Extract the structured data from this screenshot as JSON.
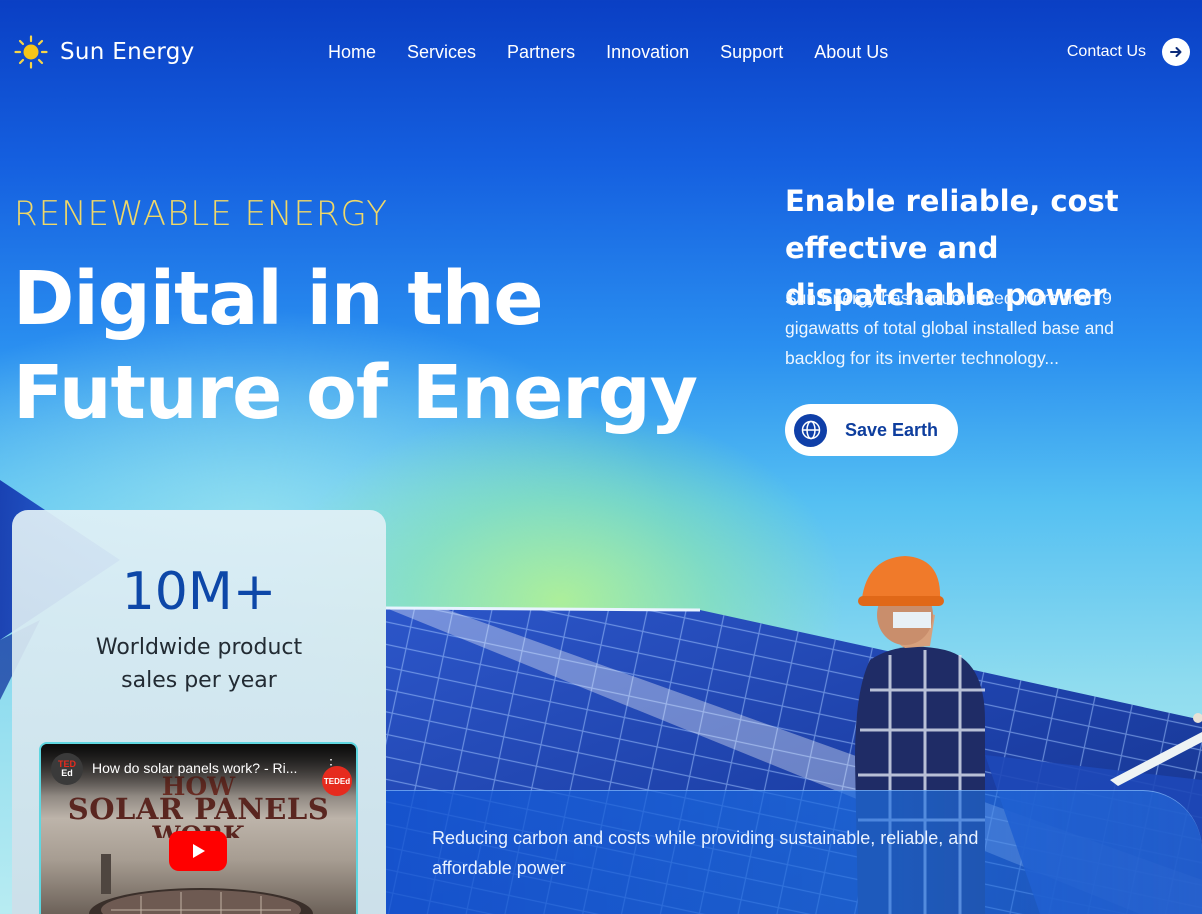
{
  "nav": {
    "brand": "Sun Energy",
    "links": [
      "Home",
      "Services",
      "Partners",
      "Innovation",
      "Support",
      "About Us"
    ],
    "contact_label": "Contact Us"
  },
  "hero": {
    "eyebrow": "RENEWABLE ENERGY",
    "headline_line1": "Digital in the",
    "headline_line2": "Future of Energy",
    "side_title": "Enable reliable, cost effective and dispatchable power",
    "side_desc": "Sun Energy has accumulated more than 9 gigawatts of total global installed base and backlog for its inverter technology...",
    "cta_label": "Save Earth"
  },
  "stat_card": {
    "value": "10M+",
    "label": "Worldwide product sales per year",
    "video": {
      "channel_badge_top": "TED",
      "channel_badge_bottom": "Ed",
      "title": "How do solar panels work? - Ri...",
      "corner_badge": "TEDEd",
      "thumb_line1": "HOW",
      "thumb_line2": "SOLAR PANELS",
      "thumb_line3": "WORK"
    }
  },
  "band": {
    "text": "Reducing carbon and costs while providing sustainable, reliable, and affordable power"
  },
  "colors": {
    "accent_yellow": "#f0d867",
    "brand_blue": "#0d47a8",
    "button_text": "#0e3e9e"
  }
}
